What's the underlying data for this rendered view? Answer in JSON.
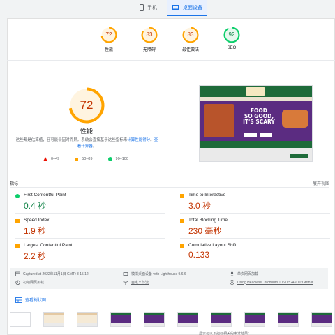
{
  "tabs": {
    "mobile": "手机",
    "desktop": "桌面设备"
  },
  "categories": [
    {
      "score": "72",
      "label": "性能",
      "fraction": 0.72,
      "color": "#ffa400"
    },
    {
      "score": "83",
      "label": "无障碍",
      "fraction": 0.83,
      "color": "#ffa400"
    },
    {
      "score": "83",
      "label": "最佳做法",
      "fraction": 0.83,
      "color": "#ffa400"
    },
    {
      "score": "92",
      "label": "SEO",
      "fraction": 0.92,
      "color": "#0cce6b"
    }
  ],
  "performance": {
    "score": "72",
    "title": "性能",
    "desc_part1": "这些都是估算值，且可能会因时而异。系统会直接基于这些指标来",
    "desc_link1": "计算性能得分",
    "desc_part2": "。",
    "desc_link2": "查看计算器",
    "desc_part3": "。"
  },
  "legend": {
    "fail": "0–49",
    "average": "50–89",
    "pass": "90–100"
  },
  "site_screenshot": {
    "headline_1": "FOOD",
    "headline_2": "SO GOOD,",
    "headline_3": "IT'S SCARY"
  },
  "metrics_header": {
    "title": "指标",
    "expand": "展开视图"
  },
  "metrics": {
    "fcp": {
      "name": "First Contentful Paint",
      "value": "0.4 秒",
      "rating": "pass"
    },
    "tti": {
      "name": "Time to Interactive",
      "value": "3.0 秒",
      "rating": "average"
    },
    "si": {
      "name": "Speed Index",
      "value": "1.9 秒",
      "rating": "average"
    },
    "tbt": {
      "name": "Total Blocking Time",
      "value": "230 毫秒",
      "rating": "average"
    },
    "lcp": {
      "name": "Largest Contentful Paint",
      "value": "2.2 秒",
      "rating": "average"
    },
    "cls": {
      "name": "Cumulative Layout Shift",
      "value": "0.133",
      "rating": "average"
    }
  },
  "run_info": {
    "captured": "Captured at 2022年11月1日 GMT+8 15:12",
    "emulation": "模拟桌面设备 with Lighthouse 9.6.6",
    "session": "单次网页加载",
    "initial_load": "初始网页加载",
    "throttling": "自定义节流",
    "browser": "Using HeadlessChromium 106.0.5249.103 with lr"
  },
  "treemap": {
    "label": "查看树状图"
  },
  "bottom_text": "显示与以下指标相关的审计结果：",
  "colors": {
    "accent": "#1a73e8",
    "fail": "#eb0f00",
    "average": "#ffa400",
    "pass": "#0cce6b",
    "average_text": "#c33300",
    "pass_text": "#0b8043"
  }
}
